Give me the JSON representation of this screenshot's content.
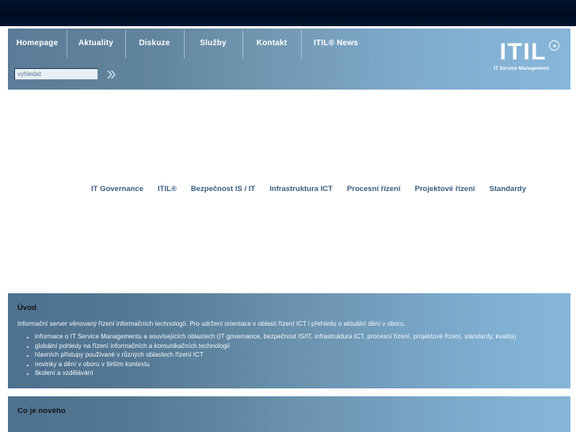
{
  "site": {
    "logo_word": "ITIL",
    "logo_registered": "registered-trademark",
    "logo_tagline": "IT Service Management"
  },
  "nav": {
    "items": [
      {
        "label": "Homepage"
      },
      {
        "label": "Aktuality"
      },
      {
        "label": "Diskuze"
      },
      {
        "label": "Služby"
      },
      {
        "label": "Kontakt"
      },
      {
        "label": "ITIL® News"
      }
    ]
  },
  "search": {
    "placeholder": "vyhledat",
    "value": "",
    "submit_icon": "double-chevron-right-icon"
  },
  "categories": [
    {
      "label": "IT Governance"
    },
    {
      "label": "ITIL®"
    },
    {
      "label": "Bezpečnost IS / IT"
    },
    {
      "label": "Infrastruktura ICT"
    },
    {
      "label": "Procesní řízení"
    },
    {
      "label": "Projektové řízení"
    },
    {
      "label": "Standardy"
    }
  ],
  "intro": {
    "title": "Úvod",
    "paragraph": "Informační server věnovaný řízení informačních technologií. Pro udržení orientace v oblasti řízení ICT i přehledu o aktuální dění v oboru.",
    "bullets": [
      "informace o IT Service Managementu a souvisejících oblastech (IT governance, bezpečnost IS/IT, infrastruktura ICT, procesní řízení, projektové řízení, standardy, kvalita)",
      "globální pohledy na řízení informačních a komunikačních technologií",
      "hlavních přístupy používané v různých oblastech řízení ICT",
      "novinky a dění v oboru v širším kontextu",
      "školení a vzdělávání"
    ]
  },
  "news": {
    "title": "Co je nového"
  },
  "colors": {
    "topbar": "#000b20",
    "header_left": "#5a7c99",
    "header_right": "#87b6d9",
    "panel_left": "#4d7190",
    "panel_right": "#85b5d8",
    "category_link": "#3b5e80",
    "page_background": "#ffffff"
  }
}
